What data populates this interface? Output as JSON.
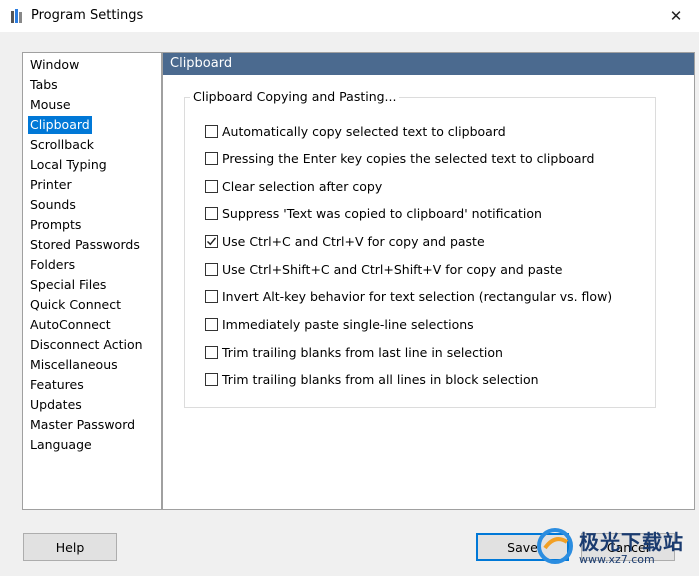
{
  "window": {
    "title": "Program Settings",
    "close_glyph": "✕"
  },
  "categories": [
    {
      "label": "Window",
      "selected": false
    },
    {
      "label": "Tabs",
      "selected": false
    },
    {
      "label": "Mouse",
      "selected": false
    },
    {
      "label": "Clipboard",
      "selected": true
    },
    {
      "label": "Scrollback",
      "selected": false
    },
    {
      "label": "Local Typing",
      "selected": false
    },
    {
      "label": "Printer",
      "selected": false
    },
    {
      "label": "Sounds",
      "selected": false
    },
    {
      "label": "Prompts",
      "selected": false
    },
    {
      "label": "Stored Passwords",
      "selected": false
    },
    {
      "label": "Folders",
      "selected": false
    },
    {
      "label": "Special Files",
      "selected": false
    },
    {
      "label": "Quick Connect",
      "selected": false
    },
    {
      "label": "AutoConnect",
      "selected": false
    },
    {
      "label": "Disconnect Action",
      "selected": false
    },
    {
      "label": "Miscellaneous",
      "selected": false
    },
    {
      "label": "Features",
      "selected": false
    },
    {
      "label": "Updates",
      "selected": false
    },
    {
      "label": "Master Password",
      "selected": false
    },
    {
      "label": "Language",
      "selected": false
    }
  ],
  "panel": {
    "header": "Clipboard",
    "group_title": "Clipboard Copying and Pasting...",
    "options": [
      {
        "label": "Automatically copy selected text to clipboard",
        "checked": false
      },
      {
        "label": "Pressing the Enter key copies the selected text to clipboard",
        "checked": false
      },
      {
        "label": "Clear selection after copy",
        "checked": false
      },
      {
        "label": "Suppress 'Text was copied to clipboard' notification",
        "checked": false
      },
      {
        "label": "Use Ctrl+C and Ctrl+V for copy and paste",
        "checked": true
      },
      {
        "label": "Use Ctrl+Shift+C and Ctrl+Shift+V for copy and paste",
        "checked": false
      },
      {
        "label": "Invert Alt-key behavior for text selection (rectangular vs. flow)",
        "checked": false
      },
      {
        "label": "Immediately paste single-line selections",
        "checked": false
      },
      {
        "label": "Trim trailing blanks from last line in selection",
        "checked": false
      },
      {
        "label": "Trim trailing blanks from all lines in block selection",
        "checked": false
      }
    ]
  },
  "buttons": {
    "help": "Help",
    "save": "Save",
    "cancel": "Cancel"
  },
  "watermark": {
    "main": "极光下载站",
    "sub": "www.xz7.com"
  },
  "colors": {
    "header_bg": "#4b6a8f",
    "selection": "#0078d7"
  }
}
